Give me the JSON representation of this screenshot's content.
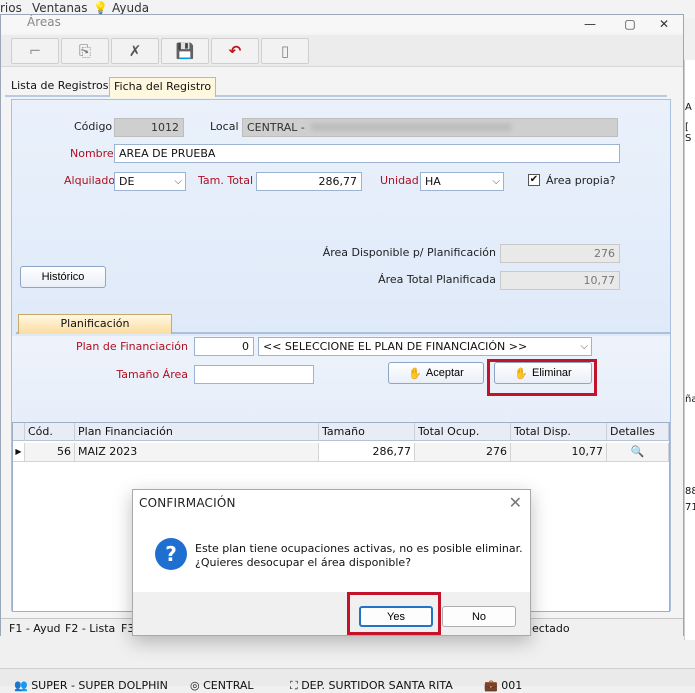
{
  "menubar": {
    "items": [
      "rios",
      "Ventanas",
      "Ayuda"
    ]
  },
  "window": {
    "title": "Áreas"
  },
  "toolbar": {
    "buttons": [
      "new-icon",
      "copy-icon",
      "delete-icon",
      "save-icon",
      "undo-icon",
      "close-doc-icon"
    ]
  },
  "tabs": [
    {
      "label": "Lista de Registros",
      "active": false
    },
    {
      "label": "Ficha del Registro",
      "active": true
    }
  ],
  "form": {
    "codigo_label": "Código",
    "codigo_value": "1012",
    "local_label": "Local",
    "local_value": "CENTRAL -",
    "nombre_label": "Nombre",
    "nombre_value": "AREA DE PRUEBA",
    "alquilado_label": "Alquilado",
    "alquilado_value": "DE",
    "tam_total_label": "Tam. Total",
    "tam_total_value": "286,77",
    "unidad_label": "Unidad",
    "unidad_value": "HA",
    "area_propia_label": "Área propia?",
    "area_propia_checked": true,
    "area_disp_label": "Área Disponible p/ Planificación",
    "area_disp_value": "276",
    "area_total_label": "Área Total Planificada",
    "area_total_value": "10,77",
    "historico_label": "Histórico"
  },
  "planificacion": {
    "tab_label": "Planificación",
    "plan_label": "Plan de Financiación",
    "plan_code": "0",
    "plan_select": "<< SELECCIONE EL PLAN DE FINANCIACIÓN >>",
    "tamano_label": "Tamaño Área",
    "tamano_value": "",
    "aceptar_label": "Aceptar",
    "eliminar_label": "Eliminar"
  },
  "grid": {
    "headers": [
      "Cód.",
      "Plan Financiación",
      "Tamaño",
      "Total Ocup.",
      "Total Disp.",
      "Detalles"
    ],
    "rows": [
      {
        "cod": "56",
        "plan": "MAIZ 2023",
        "tamano": "286,77",
        "total_ocup": "276",
        "total_disp": "10,77"
      }
    ]
  },
  "statusbar": {
    "items": [
      "F1 - Ayud",
      "F2 - Lista",
      "F3",
      "ectado"
    ]
  },
  "dialog": {
    "title": "CONFIRMACIÓN",
    "message_line1": "Este plan tiene ocupaciones activas, no es posible eliminar.",
    "message_line2": "¿Quieres desocupar el área disponible?",
    "yes_label": "Yes",
    "no_label": "No"
  },
  "taskbar": {
    "items": [
      "SUPER - SUPER DOLPHIN",
      "CENTRAL",
      "DEP. SURTIDOR SANTA RITA",
      "001"
    ]
  },
  "right_fragments": [
    "A",
    "[ S",
    "ña",
    "88",
    "71"
  ],
  "colors": {
    "highlight_box": "#c4122a",
    "required_label": "#b01020",
    "panel_blue": "#d2e1f6"
  }
}
